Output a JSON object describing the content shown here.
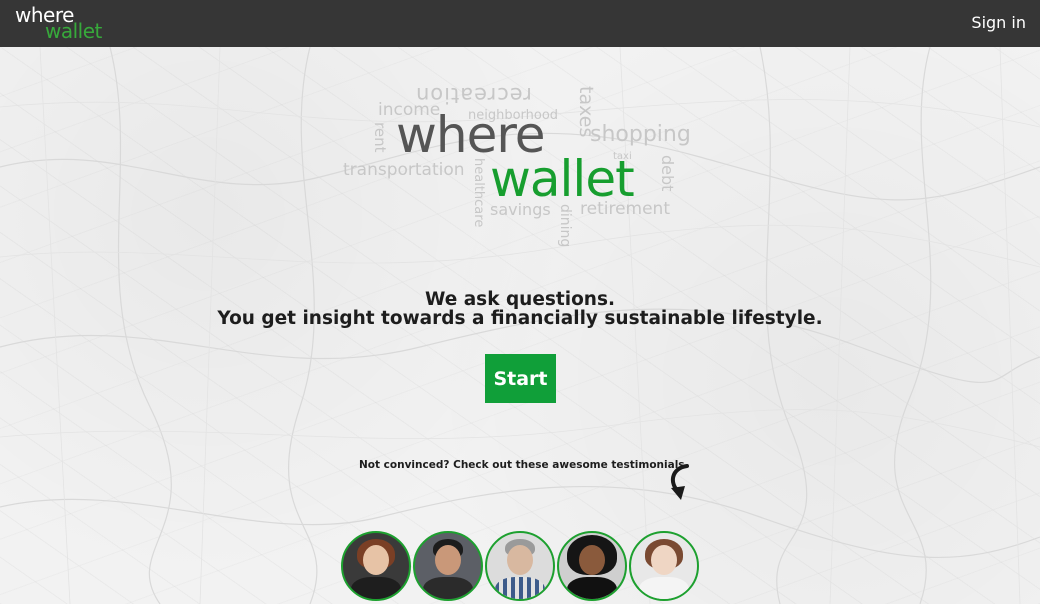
{
  "header": {
    "logo_line1": "where",
    "logo_line2": "wallet",
    "signin_label": "Sign in"
  },
  "word_cloud": {
    "words": [
      "recreation",
      "income",
      "neighborhood",
      "taxes",
      "shopping",
      "rent",
      "taxi",
      "debt",
      "transportation",
      "healthcare",
      "savings",
      "dining",
      "retirement"
    ],
    "logo_where": "where",
    "logo_wallet": "wallet"
  },
  "hero": {
    "line1": "We ask questions.",
    "line2": "You get insight towards a financially sustainable lifestyle.",
    "start_label": "Start"
  },
  "testimonials": {
    "note": "Not convinced? Check out these awesome testimonials.",
    "avatars": [
      "avatar-1",
      "avatar-2",
      "avatar-3",
      "avatar-4",
      "avatar-5"
    ]
  },
  "colors": {
    "topbar": "#363636",
    "brand_green": "#109f39",
    "logo_green": "#37a93b"
  }
}
